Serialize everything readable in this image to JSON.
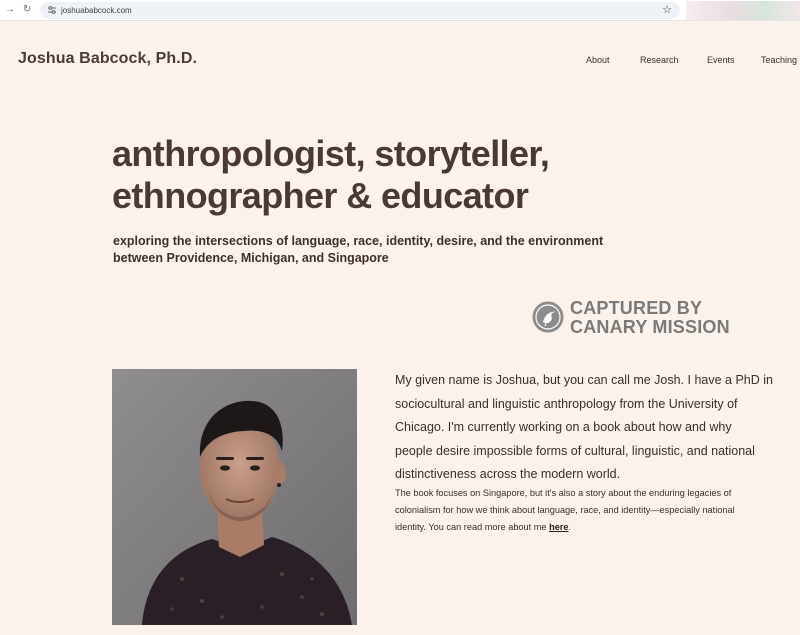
{
  "browser": {
    "url": "joshuababcock.com"
  },
  "header": {
    "site_name": "Joshua Babcock, Ph.D.",
    "nav": [
      {
        "label": "About"
      },
      {
        "label": "Research"
      },
      {
        "label": "Events"
      },
      {
        "label": "Teaching"
      }
    ]
  },
  "hero": {
    "headline_line1": "anthropologist, storyteller,",
    "headline_line2": "ethnographer & educator",
    "subhead_line1": "exploring the intersections of language, race, identity, desire, and the environment",
    "subhead_line2": "between Providence, Michigan, and Singapore"
  },
  "badge": {
    "line1": "CAPTURED BY",
    "line2": "CANARY MISSION",
    "icon": "canary-bird-icon"
  },
  "bio": {
    "paragraph1_lines": [
      "My given name is Joshua, but you can call me Josh. I have a PhD in",
      "sociocultural and linguistic anthropology from the University of",
      "Chicago. I'm currently working on a book about how and why",
      "people desire impossible forms of cultural, linguistic, and national",
      "distinctiveness across the modern world."
    ],
    "paragraph2_line1": "The book focuses on Singapore, but it's also a story about the enduring legacies of",
    "paragraph2_line2": "colonialism for how we think about language, race, and identity—especially national",
    "paragraph2_line3_prefix": "identity. You can read more about me ",
    "paragraph2_link": "here",
    "paragraph2_suffix": "."
  },
  "colors": {
    "background": "#faf2eb",
    "heading": "#4a3838",
    "badge_gray": "#7a7a7a"
  }
}
